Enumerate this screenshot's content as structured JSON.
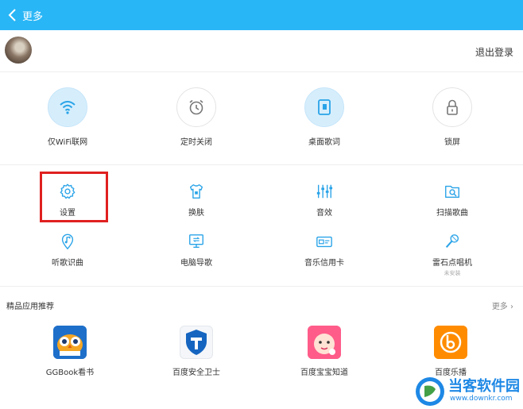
{
  "header": {
    "title": "更多",
    "back_icon": "chevron-left-icon",
    "bg_color": "#29b6f6"
  },
  "account": {
    "logout_label": "退出登录"
  },
  "quick_actions": [
    {
      "label": "仅WiFi联网",
      "icon": "wifi-icon",
      "active": true
    },
    {
      "label": "定时关闭",
      "icon": "alarm-clock-icon",
      "active": false
    },
    {
      "label": "桌面歌词",
      "icon": "desktop-lyrics-icon",
      "active": true
    },
    {
      "label": "锁屏",
      "icon": "lock-icon",
      "active": false
    }
  ],
  "tools": [
    {
      "label": "设置",
      "icon": "gear-icon"
    },
    {
      "label": "换肤",
      "icon": "shirt-icon"
    },
    {
      "label": "音效",
      "icon": "equalizer-icon"
    },
    {
      "label": "扫描歌曲",
      "icon": "scan-folder-icon"
    },
    {
      "label": "听歌识曲",
      "icon": "music-location-icon"
    },
    {
      "label": "电脑导歌",
      "icon": "computer-transfer-icon"
    },
    {
      "label": "音乐信用卡",
      "icon": "credit-card-icon"
    },
    {
      "label": "雷石点唱机",
      "icon": "microphone-icon",
      "sub": "未安装"
    }
  ],
  "recommend": {
    "title": "精品应用推荐",
    "more_label": "更多",
    "apps": [
      {
        "label": "GGBook看书",
        "icon": "owl-icon"
      },
      {
        "label": "百度安全卫士",
        "icon": "shield-icon"
      },
      {
        "label": "百度宝宝知道",
        "icon": "baby-icon"
      },
      {
        "label": "百度乐播",
        "icon": "lebo-icon"
      }
    ]
  },
  "watermark": {
    "name": "当客软件园",
    "url": "www.downkr.com"
  }
}
